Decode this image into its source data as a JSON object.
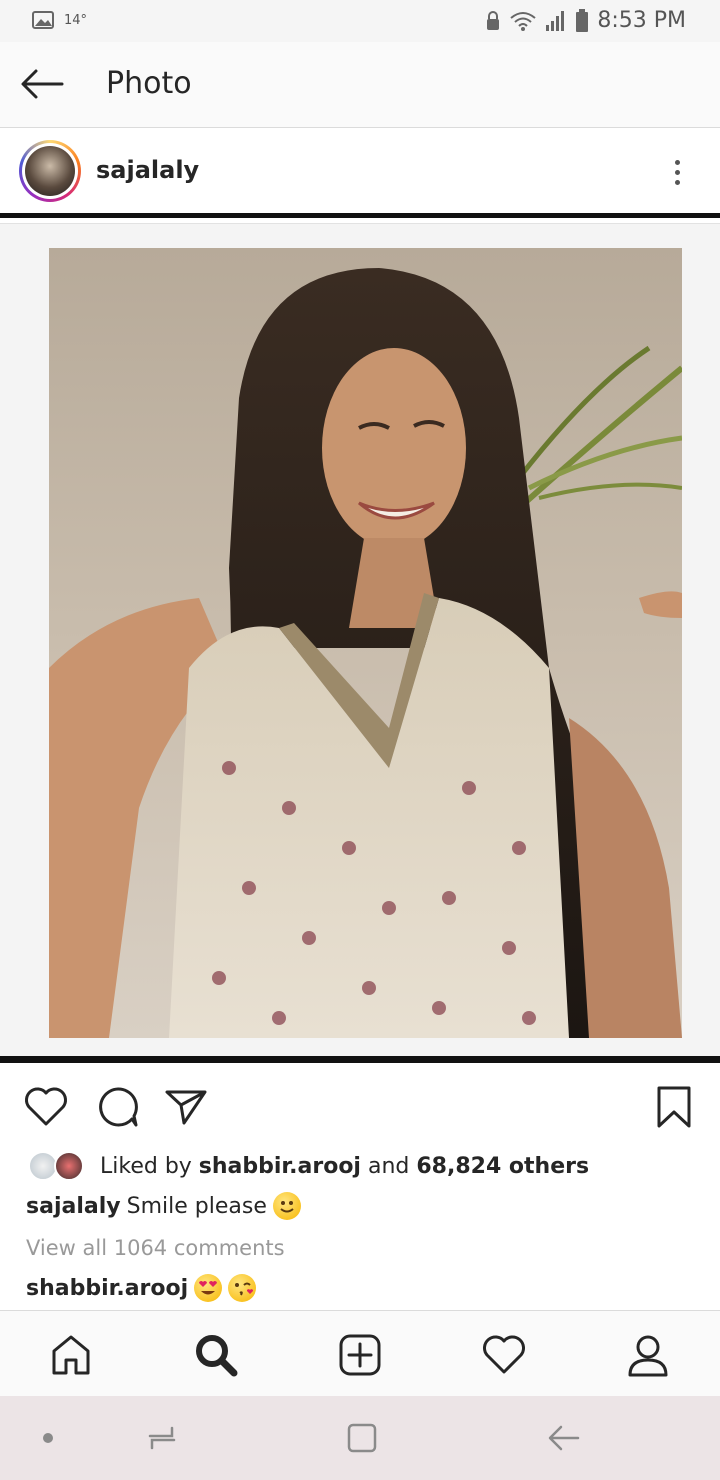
{
  "status_bar": {
    "temperature": "14°",
    "time": "8:53 PM"
  },
  "header": {
    "title": "Photo"
  },
  "post": {
    "username": "sajalaly"
  },
  "likes": {
    "prefix": "Liked by ",
    "user": "shabbir.arooj",
    "middle": " and ",
    "others": "68,824 others"
  },
  "caption": {
    "user": "sajalaly",
    "text": "Smile please"
  },
  "comments": {
    "view_all": "View all 1064 comments"
  },
  "comment": {
    "user": "shabbir.arooj"
  },
  "icons": {
    "back": "arrow-left-icon",
    "more": "more-vertical-icon",
    "like": "heart-icon",
    "comment": "comment-icon",
    "share": "send-icon",
    "save": "bookmark-icon",
    "home": "home-icon",
    "search": "search-icon",
    "add": "add-post-icon",
    "activity": "heart-icon",
    "profile": "profile-icon"
  },
  "colors": {
    "text": "#262626",
    "muted": "#999999",
    "border": "#dbdbdb"
  }
}
